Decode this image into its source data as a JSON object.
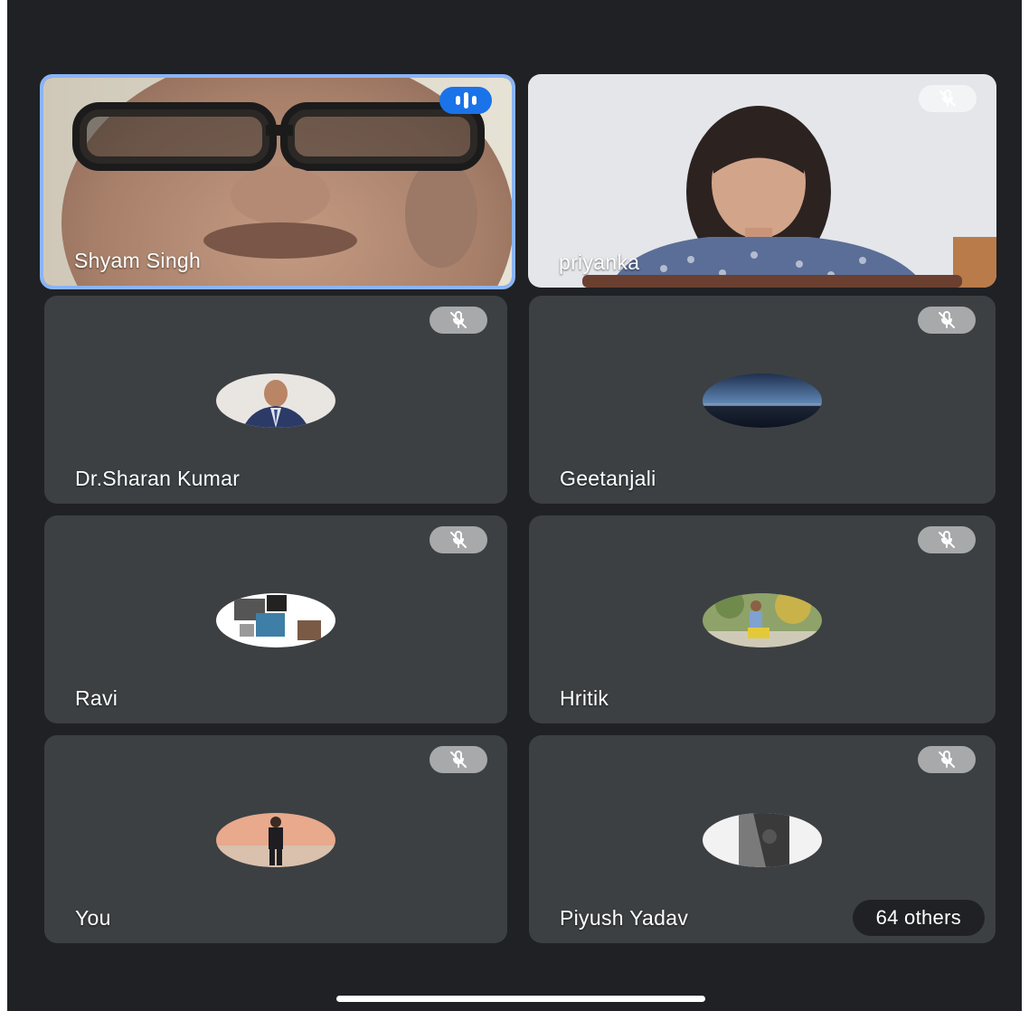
{
  "participants": [
    {
      "name": "Shyam Singh",
      "state": "speaking"
    },
    {
      "name": "priyanka",
      "state": "muted"
    },
    {
      "name": "Dr.Sharan Kumar",
      "state": "muted"
    },
    {
      "name": "Geetanjali",
      "state": "muted"
    },
    {
      "name": "Ravi",
      "state": "muted"
    },
    {
      "name": "Hritik",
      "state": "muted"
    },
    {
      "name": "You",
      "state": "muted"
    },
    {
      "name": "Piyush Yadav",
      "state": "muted"
    }
  ],
  "others_label": "64 others",
  "icons": {
    "muted": "mic-off-icon",
    "speaking": "audio-level-icon"
  },
  "colors": {
    "background": "#202124",
    "tile": "#3c4043",
    "active_border": "#8ab4f8",
    "speaking_badge": "#1a73e8"
  }
}
